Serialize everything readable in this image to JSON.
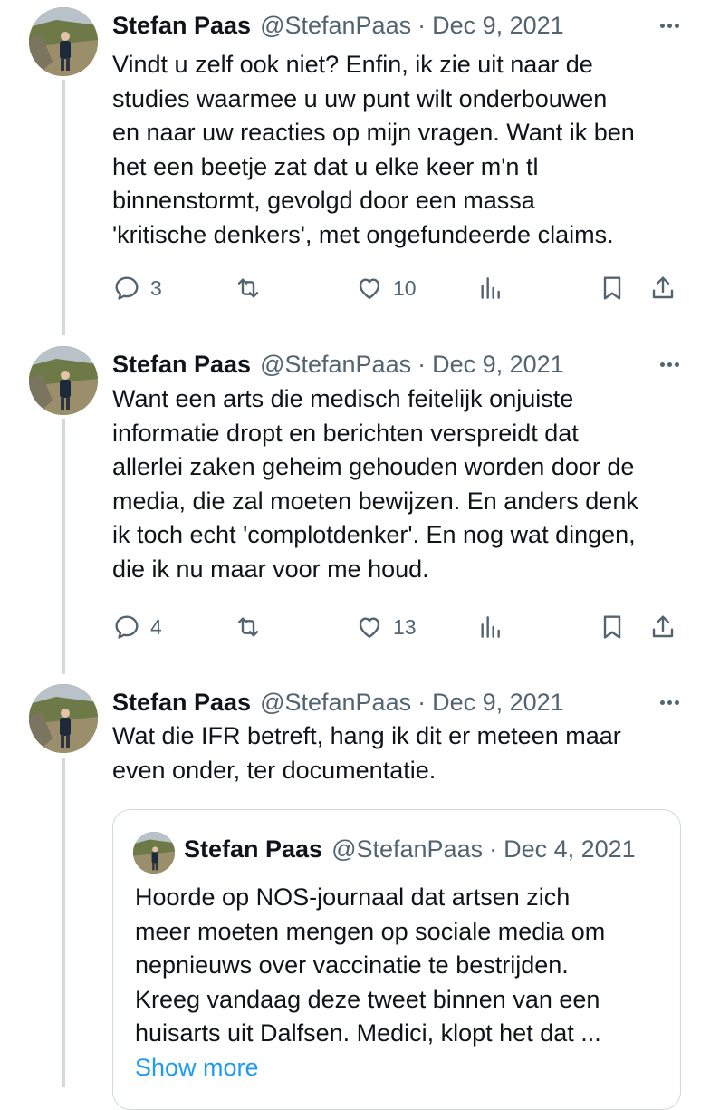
{
  "colors": {
    "text": "#0f1419",
    "secondary": "#536471",
    "link": "#1d9bf0",
    "line": "#cfd9de"
  },
  "tweets": [
    {
      "name": "Stefan Paas",
      "handle": "@StefanPaas",
      "sep": "·",
      "date": "Dec 9, 2021",
      "lines": [
        "Vindt u zelf ook niet? Enfin, ik zie uit naar de",
        "studies waarmee u uw punt wilt onderbouwen",
        "en naar uw reacties op mijn vragen. Want ik ben",
        "het een beetje zat dat u elke keer m'n tl",
        "binnenstormt, gevolgd door een massa",
        "'kritische denkers', met ongefundeerde claims."
      ],
      "replies": "3",
      "likes": "10"
    },
    {
      "name": "Stefan Paas",
      "handle": "@StefanPaas",
      "sep": "·",
      "date": "Dec 9, 2021",
      "lines": [
        "Want een arts die medisch feitelijk onjuiste",
        "informatie dropt en berichten verspreidt dat",
        "allerlei zaken geheim gehouden worden door de",
        "media, die zal moeten bewijzen. En anders denk",
        "ik toch echt 'complotdenker'. En nog wat dingen,",
        "die ik nu maar voor me houd."
      ],
      "replies": "4",
      "likes": "13"
    },
    {
      "name": "Stefan Paas",
      "handle": "@StefanPaas",
      "sep": "·",
      "date": "Dec 9, 2021",
      "lines": [
        "Wat die IFR betreft, hang ik dit er meteen maar",
        "even onder, ter documentatie."
      ]
    }
  ],
  "quote": {
    "name": "Stefan Paas",
    "handle": "@StefanPaas",
    "sep": "·",
    "date": "Dec 4, 2021",
    "lines": [
      "Hoorde op NOS-journaal dat artsen zich",
      "meer moeten mengen op sociale media om",
      "nepnieuws over vaccinatie te bestrijden.",
      "Kreeg vandaag deze tweet binnen van een",
      "huisarts uit Dalfsen. Medici, klopt het dat ..."
    ],
    "show_more": "Show more"
  }
}
